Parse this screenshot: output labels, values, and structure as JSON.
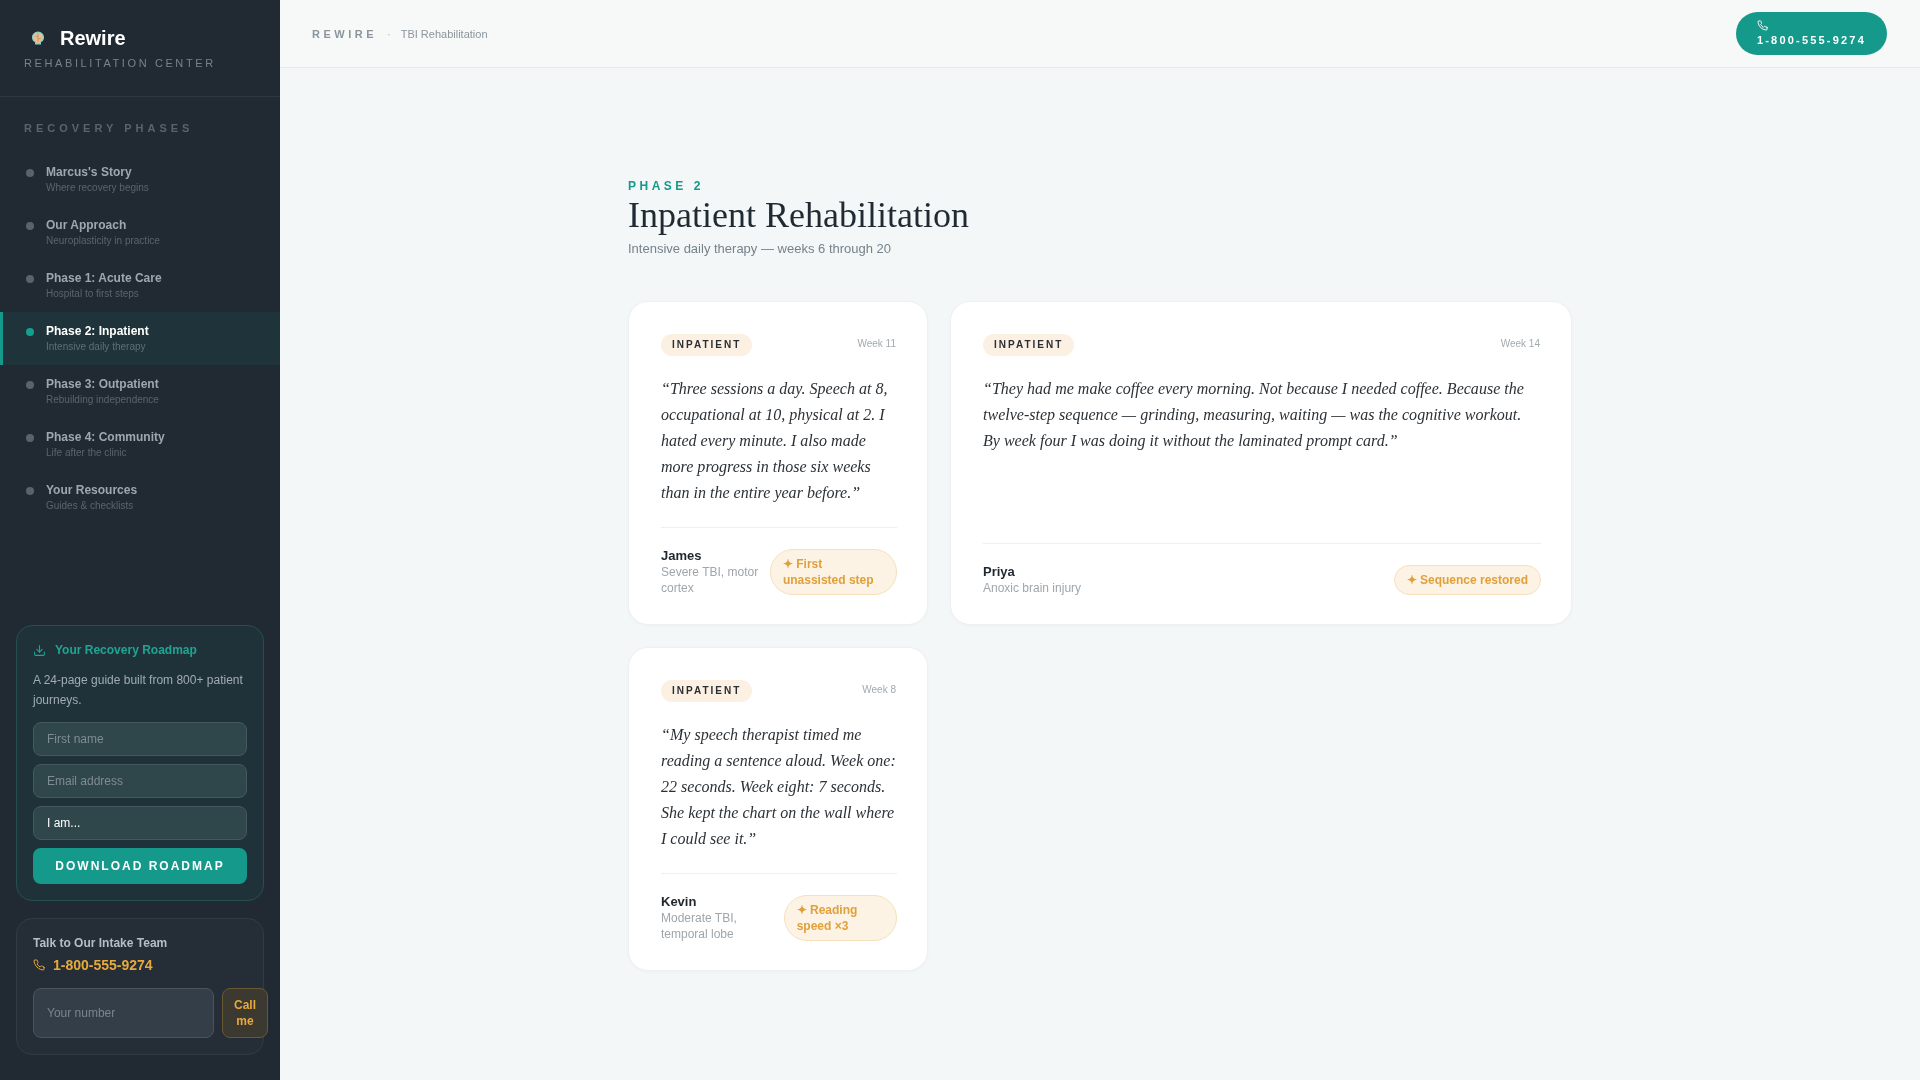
{
  "sidebar": {
    "brand": {
      "name": "Rewire",
      "tagline": "REHABILITATION CENTER"
    },
    "section_title": "RECOVERY PHASES",
    "items": [
      {
        "title": "Marcus's Story",
        "subtitle": "Where recovery begins",
        "selected": false
      },
      {
        "title": "Our Approach",
        "subtitle": "Neuroplasticity in practice",
        "selected": false
      },
      {
        "title": "Phase 1: Acute Care",
        "subtitle": "Hospital to first steps",
        "selected": false
      },
      {
        "title": "Phase 2: Inpatient",
        "subtitle": "Intensive daily therapy",
        "selected": true
      },
      {
        "title": "Phase 3: Outpatient",
        "subtitle": "Rebuilding independence",
        "selected": false
      },
      {
        "title": "Phase 4: Community",
        "subtitle": "Life after the clinic",
        "selected": false
      },
      {
        "title": "Your Resources",
        "subtitle": "Guides & checklists",
        "selected": false
      }
    ],
    "roadmap": {
      "title": "Your Recovery Roadmap",
      "description": "A 24-page guide built from 800+ patient journeys.",
      "fields": [
        {
          "placeholder": "First name"
        },
        {
          "placeholder": "Email address"
        }
      ],
      "select": {
        "value": "I am..."
      },
      "button": "DOWNLOAD ROADMAP"
    },
    "intake": {
      "title": "Talk to Our Intake Team",
      "phone": "1-800-555-9274",
      "field": {
        "placeholder": "Your number"
      },
      "button": "Call me"
    }
  },
  "top_bar": {
    "brand": "REWIRE",
    "separator": "·",
    "section": "TBI Rehabilitation",
    "phone_button": "1-800-555-9274"
  },
  "header": {
    "eyebrow": "PHASE 2",
    "title": "Inpatient Rehabilitation",
    "subtitle": "Intensive daily therapy — weeks 6 through 20"
  },
  "stories": [
    {
      "tag": "INPATIENT",
      "week": "Week 11",
      "quote": "“Three sessions a day. Speech at 8, occupational at 10, physical at 2. I hated every minute. I also made more progress in those six weeks than in the entire year before.”",
      "name": "James",
      "condition": "Severe TBI, motor cortex",
      "milestone": "✦ First unassisted step"
    },
    {
      "tag": "INPATIENT",
      "week": "Week 14",
      "quote": "“They had me make coffee every morning. Not because I needed coffee. Because the twelve-step sequence — grinding, measuring, waiting — was the cognitive workout. By week four I was doing it without the laminated prompt card.”",
      "name": "Priya",
      "condition": "Anoxic brain injury",
      "milestone": "✦ Sequence restored"
    },
    {
      "tag": "INPATIENT",
      "week": "Week 8",
      "quote": "“My speech therapist timed me reading a sentence aloud. Week one: 22 seconds. Week eight: 7 seconds. She kept the chart on the wall where I could see it.”",
      "name": "Kevin",
      "condition": "Moderate TBI, temporal lobe",
      "milestone": "✦ Reading speed ×3"
    }
  ]
}
